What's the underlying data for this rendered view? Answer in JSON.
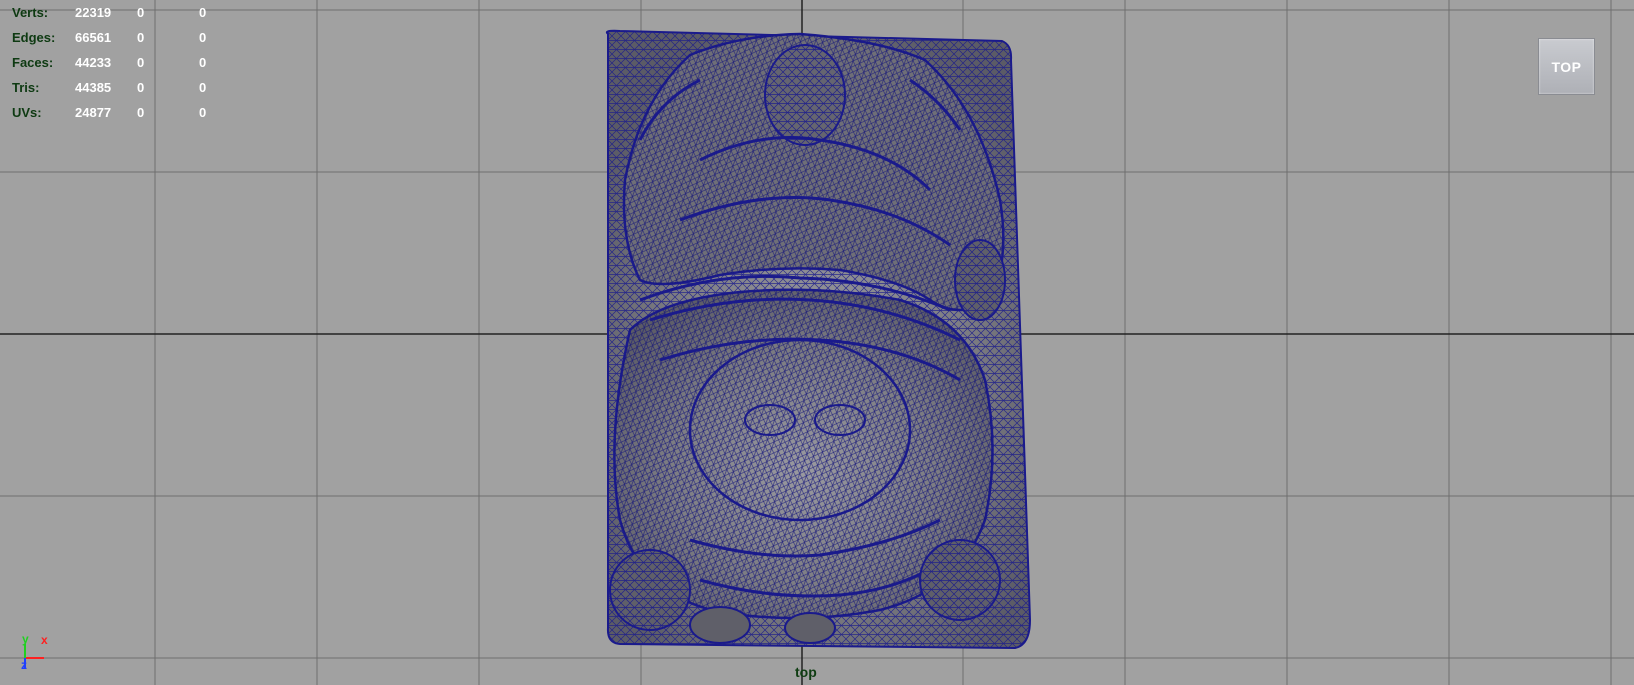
{
  "hud": {
    "rows": [
      {
        "label": "Verts:",
        "total": "22319",
        "selected": "0",
        "component": "0"
      },
      {
        "label": "Edges:",
        "total": "66561",
        "selected": "0",
        "component": "0"
      },
      {
        "label": "Faces:",
        "total": "44233",
        "selected": "0",
        "component": "0"
      },
      {
        "label": "Tris:",
        "total": "44385",
        "selected": "0",
        "component": "0"
      },
      {
        "label": "UVs:",
        "total": "24877",
        "selected": "0",
        "component": "0"
      }
    ]
  },
  "view_cube": {
    "label": "TOP"
  },
  "camera": {
    "name": "top"
  },
  "axis_gizmo": {
    "x_label": "x",
    "y_label": "y",
    "z_label": "z"
  },
  "colors": {
    "viewport_bg": "#a1a1a1",
    "grid_line": "#6e6e6e",
    "grid_axis": "#222222",
    "wireframe": "#1a1a8c",
    "mesh_shade": "#7b7b80",
    "hud_label": "#0e3a12",
    "hud_value": "#ffffff",
    "axis_x": "#ff2020",
    "axis_y": "#20d020",
    "axis_z": "#2040ff"
  },
  "icons": {
    "view_cube": "view-cube-icon",
    "axis": "axis-gizmo-icon"
  }
}
